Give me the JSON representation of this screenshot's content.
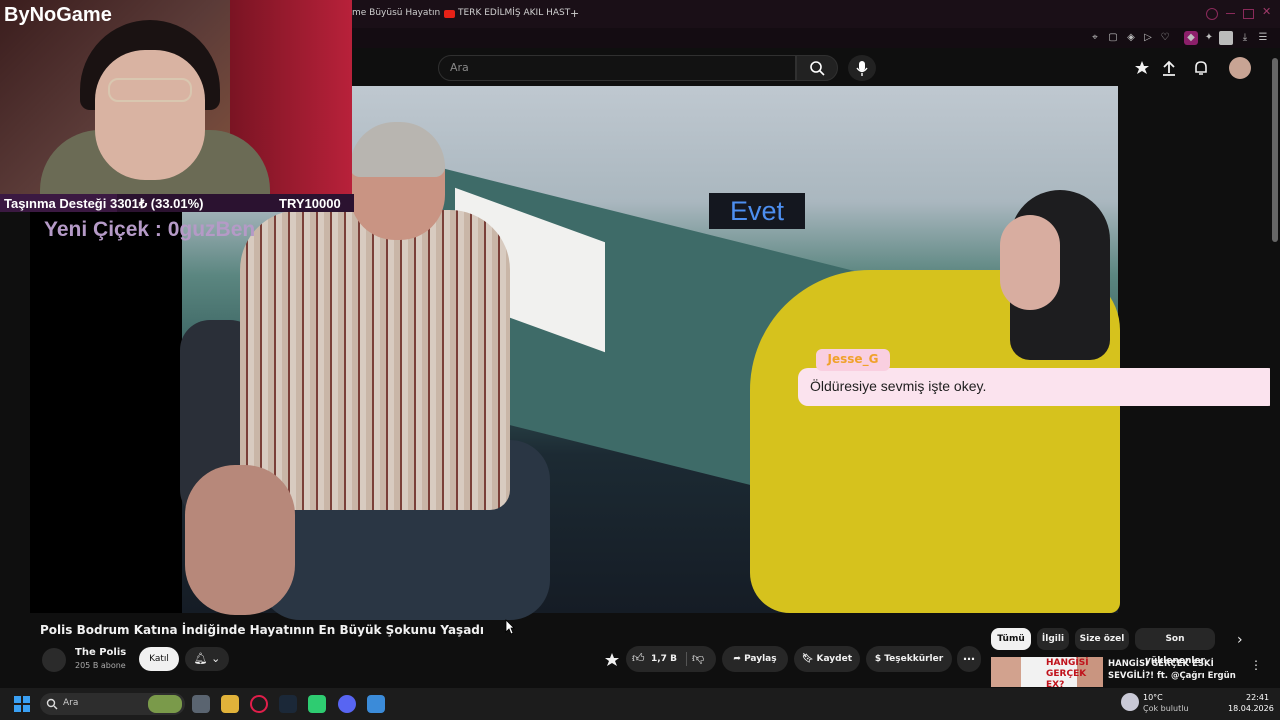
{
  "browser": {
    "tabs": [
      {
        "label": "me Büyüsü Hayatın"
      },
      {
        "label": "TERK EDİLMİŞ AKIL HAST"
      }
    ],
    "new_tab": "+"
  },
  "youtube": {
    "search_placeholder": "Ara",
    "video": {
      "caption": "Evet",
      "title": "Polis Bodrum Katına İndiğinde Hayatının En Büyük Şokunu Yaşadı",
      "channel_name": "The Polis",
      "channel_subs": "205 B abone",
      "join_label": "Katıl",
      "likes": "1,7 B",
      "share_label": "Paylaş",
      "save_label": "Kaydet",
      "thanks_label": "Teşekkürler"
    },
    "chips": [
      "Tümü",
      "İlgili",
      "Size özel",
      "Son yüklenenler"
    ],
    "recommendation": {
      "thumb_text": "HANGİSİ GERÇEK EX?",
      "title": "HANGİSİ GERÇEK ESKİ SEVGİLİ?! ft. @Çağrı Ergün"
    }
  },
  "overlay": {
    "logo": "ByNoGame",
    "donation_text": "Taşınma Desteği 3301₺ (33.01%)",
    "donation_goal": "TRY10000",
    "donation_progress": 0.3301,
    "new_flower": "Yeni Çiçek : 0guzBen",
    "chat_user": "Jesse_G",
    "chat_message": "Öldüresiye sevmiş işte okey."
  },
  "taskbar": {
    "search_placeholder": "Ara",
    "weather_temp": "10°C",
    "weather_desc": "Çok bulutlu",
    "time": "22:41",
    "date": "18.04.2026"
  },
  "colors": {
    "accent_caption": "#4d8ff0",
    "chat_bg": "#fbe3ee",
    "chat_user": "#f0a12a"
  }
}
